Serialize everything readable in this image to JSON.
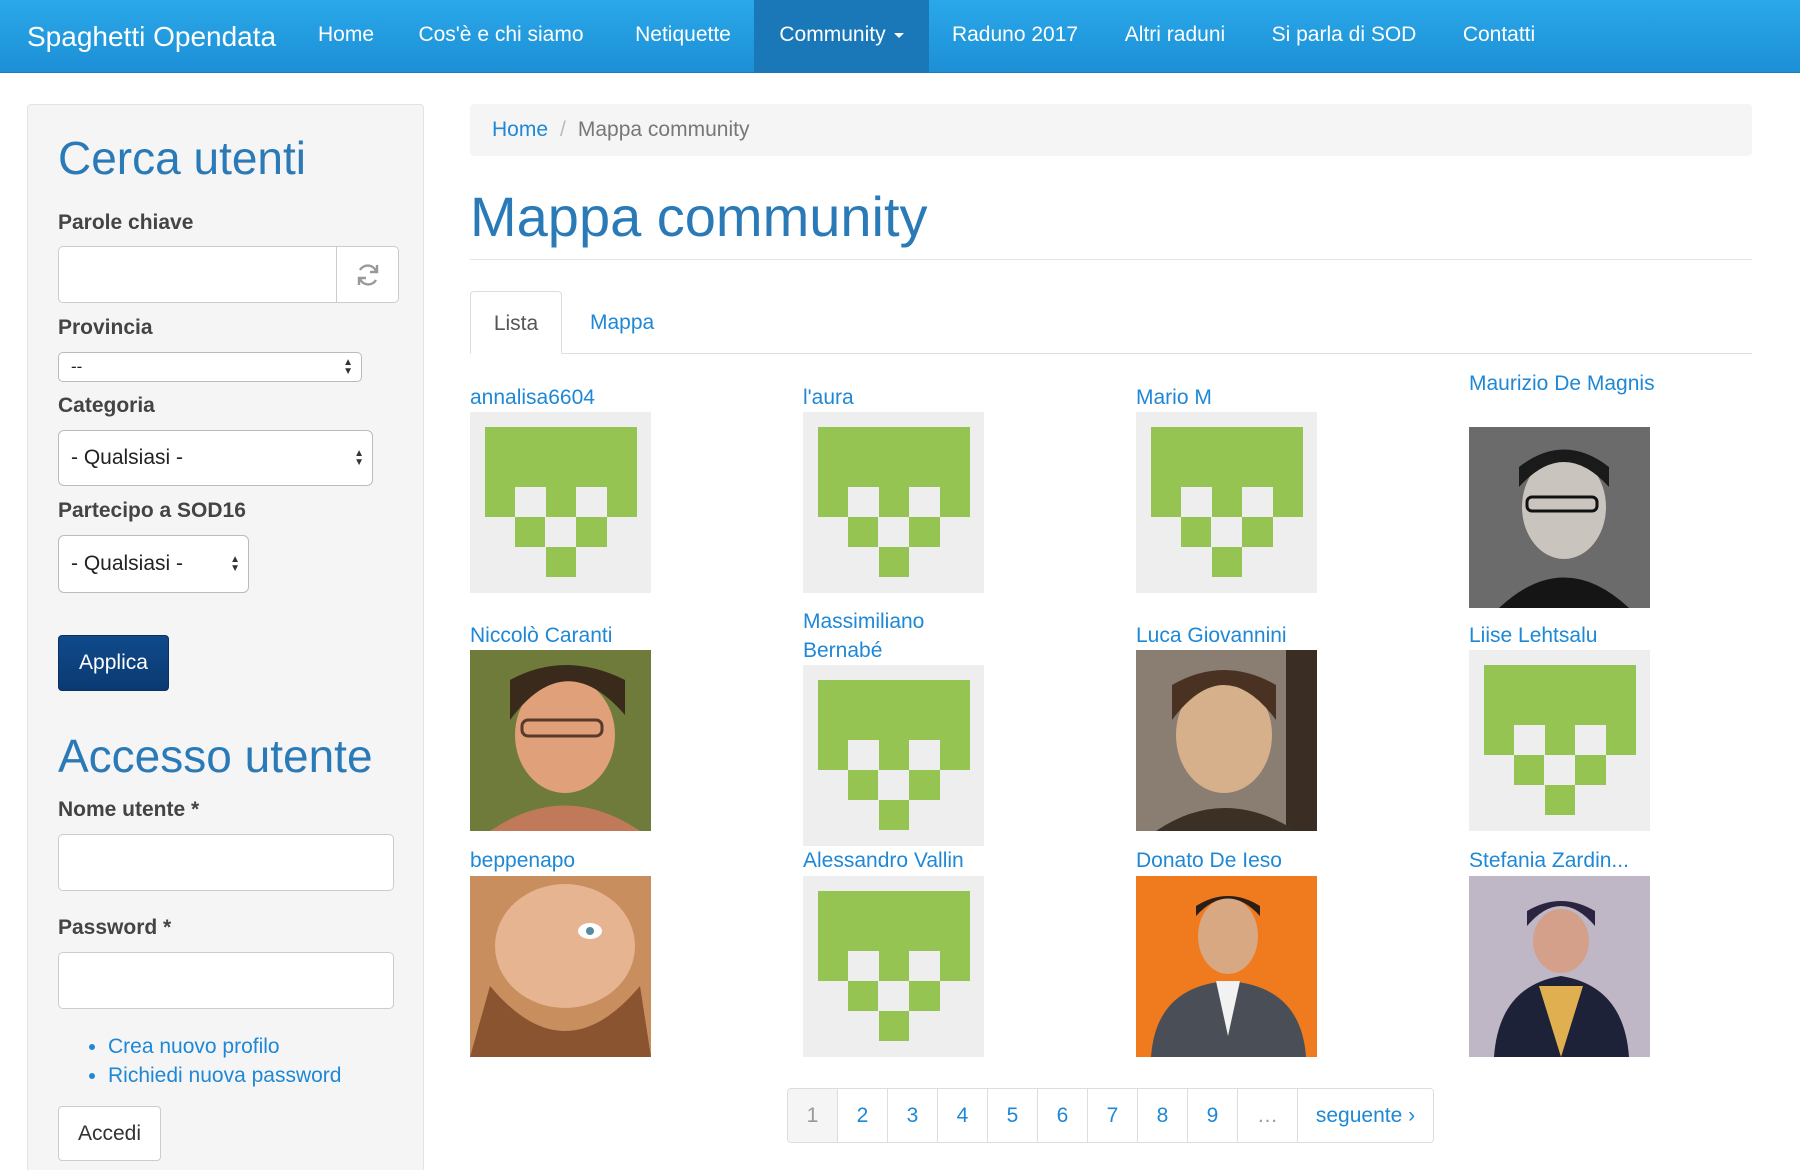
{
  "nav": {
    "brand": "Spaghetti Opendata",
    "items": [
      {
        "label": "Home"
      },
      {
        "label": "Cos'è e chi siamo"
      },
      {
        "label": "Netiquette"
      },
      {
        "label": "Community"
      },
      {
        "label": "Raduno 2017"
      },
      {
        "label": "Altri raduni"
      },
      {
        "label": "Si parla di SOD"
      },
      {
        "label": "Contatti"
      }
    ],
    "active_item": "Community"
  },
  "sidebar": {
    "search_title": "Cerca utenti",
    "keywords_label": "Parole chiave",
    "keywords_value": "",
    "province_label": "Provincia",
    "province_value": "--",
    "category_label": "Categoria",
    "category_value": "- Qualsiasi -",
    "participate_label": "Partecipo a SOD16",
    "participate_value": "- Qualsiasi -",
    "apply_label": "Applica",
    "login_title": "Accesso utente",
    "username_label": "Nome utente *",
    "username_value": "",
    "password_label": "Password *",
    "password_value": "",
    "links": [
      "Crea nuovo profilo",
      "Richiedi nuova password"
    ],
    "login_button": "Accedi"
  },
  "breadcrumb": {
    "home": "Home",
    "separator": "/",
    "current": "Mappa community"
  },
  "page_title": "Mappa community",
  "tabs": [
    {
      "label": "Lista",
      "active": true
    },
    {
      "label": "Mappa",
      "active": false
    }
  ],
  "users": [
    {
      "name": "annalisa6604",
      "avatar": "default-avatar-icon"
    },
    {
      "name": "l'aura",
      "avatar": "default-avatar-icon"
    },
    {
      "name": "Mario M",
      "avatar": "default-avatar-icon"
    },
    {
      "name": "Maurizio De Magnis",
      "avatar": "user-photo"
    },
    {
      "name": "Niccolò Caranti",
      "avatar": "user-photo"
    },
    {
      "name": "Massimiliano Bernabé",
      "avatar": "default-avatar-icon"
    },
    {
      "name": "Luca Giovannini",
      "avatar": "user-photo"
    },
    {
      "name": "Liise Lehtsalu",
      "avatar": "default-avatar-icon"
    },
    {
      "name": "beppenapo",
      "avatar": "user-photo"
    },
    {
      "name": "Alessandro Vallin",
      "avatar": "default-avatar-icon"
    },
    {
      "name": "Donato De Ieso",
      "avatar": "user-photo"
    },
    {
      "name": "Stefania Zardin...",
      "avatar": "user-photo"
    }
  ],
  "pagination": {
    "pages": [
      "1",
      "2",
      "3",
      "4",
      "5",
      "6",
      "7",
      "8",
      "9",
      "…"
    ],
    "current": "1",
    "next": "seguente ›"
  },
  "colors": {
    "nav_bg": "#1d8fd6",
    "link": "#1e88d6",
    "heading": "#2a7ab8",
    "avatar_green": "#95c453",
    "primary_button": "#0b3a72"
  }
}
